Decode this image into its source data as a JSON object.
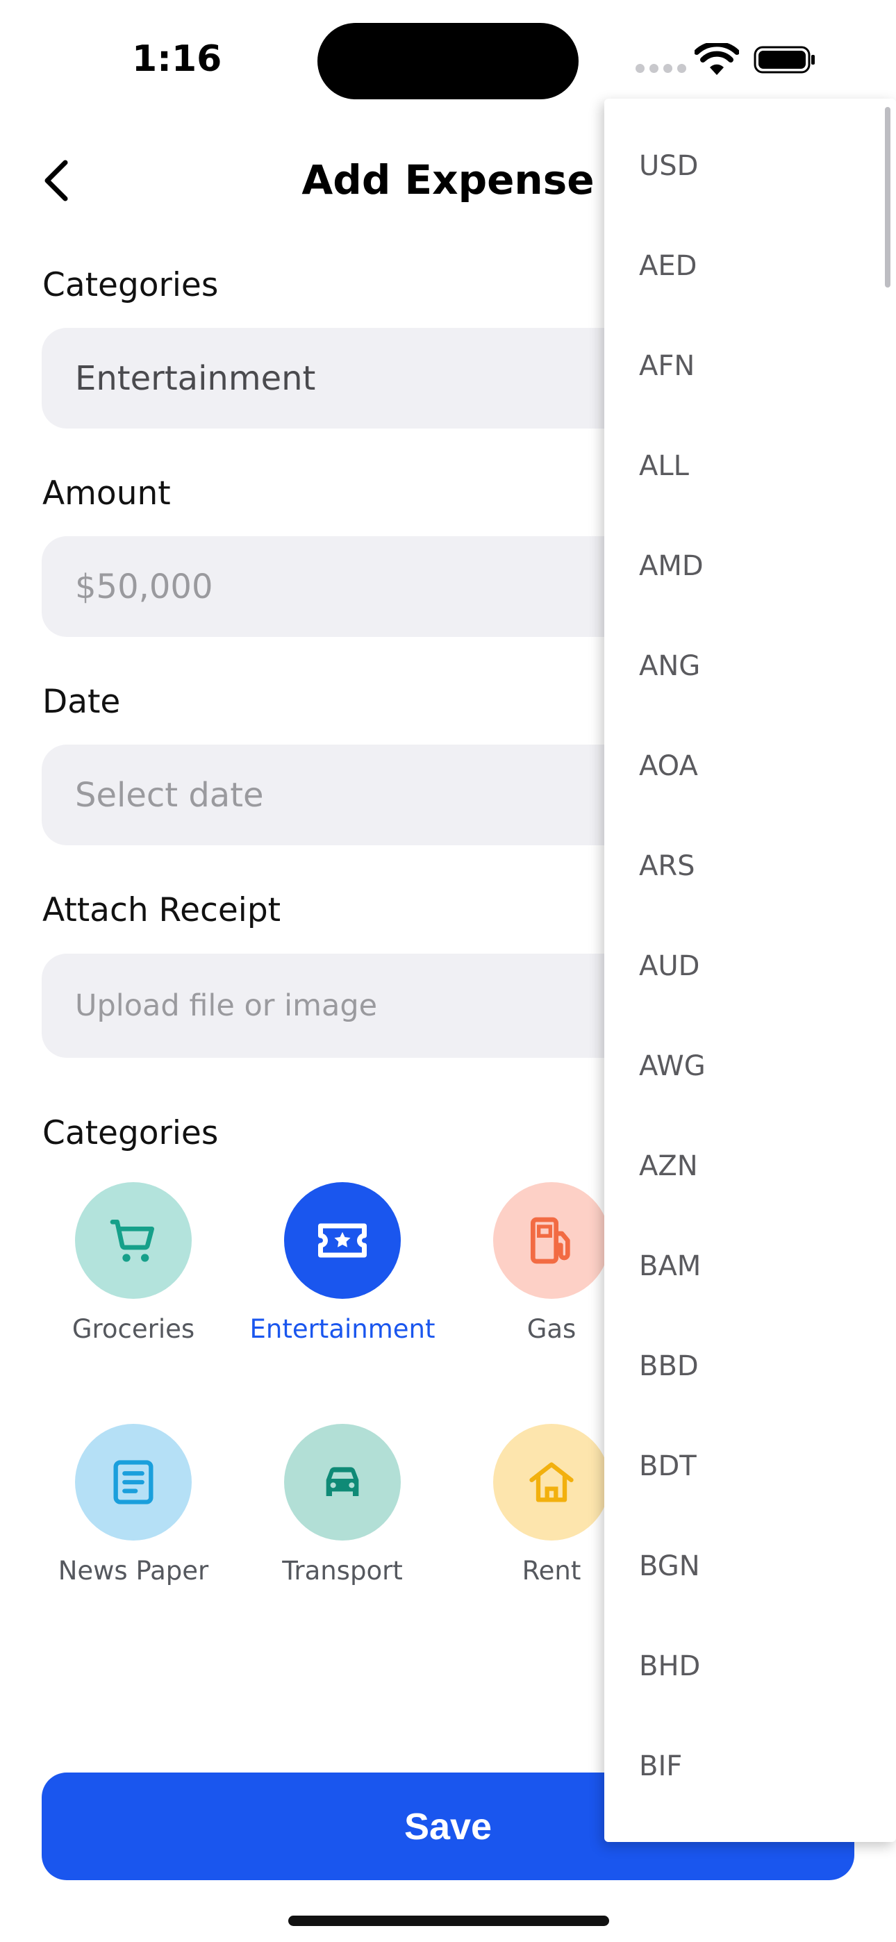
{
  "status": {
    "time": "1:16"
  },
  "header": {
    "title": "Add Expense"
  },
  "form": {
    "category_label": "Categories",
    "category_value": "Entertainment",
    "amount_label": "Amount",
    "amount_placeholder": "$50,000",
    "date_label": "Date",
    "date_placeholder": "Select date",
    "receipt_label": "Attach Receipt",
    "receipt_placeholder": "Upload file or image"
  },
  "categories": {
    "label": "Categories",
    "items": [
      {
        "name": "Groceries",
        "icon": "cart-icon",
        "bg": "#b3e3dc",
        "fg": "#16a08a",
        "active": false
      },
      {
        "name": "Entertainment",
        "icon": "ticket-icon",
        "bg": "#1a56ee",
        "fg": "#ffffff",
        "active": true
      },
      {
        "name": "Gas",
        "icon": "fuel-icon",
        "bg": "#fdd0c6",
        "fg": "#f26b43",
        "active": false
      },
      {
        "name": "News Paper",
        "icon": "document-icon",
        "bg": "#b5e0f6",
        "fg": "#1a9fdc",
        "active": false
      },
      {
        "name": "Transport",
        "icon": "car-icon",
        "bg": "#b2dfd6",
        "fg": "#0f8a76",
        "active": false
      },
      {
        "name": "Rent",
        "icon": "home-icon",
        "bg": "#fde5ad",
        "fg": "#f2b00e",
        "active": false
      }
    ]
  },
  "save_label": "Save",
  "currency_dropdown": {
    "options": [
      "USD",
      "AED",
      "AFN",
      "ALL",
      "AMD",
      "ANG",
      "AOA",
      "ARS",
      "AUD",
      "AWG",
      "AZN",
      "BAM",
      "BBD",
      "BDT",
      "BGN",
      "BHD",
      "BIF"
    ]
  },
  "colors": {
    "accent": "#1a56ee",
    "field_bg": "#f0f0f4"
  }
}
